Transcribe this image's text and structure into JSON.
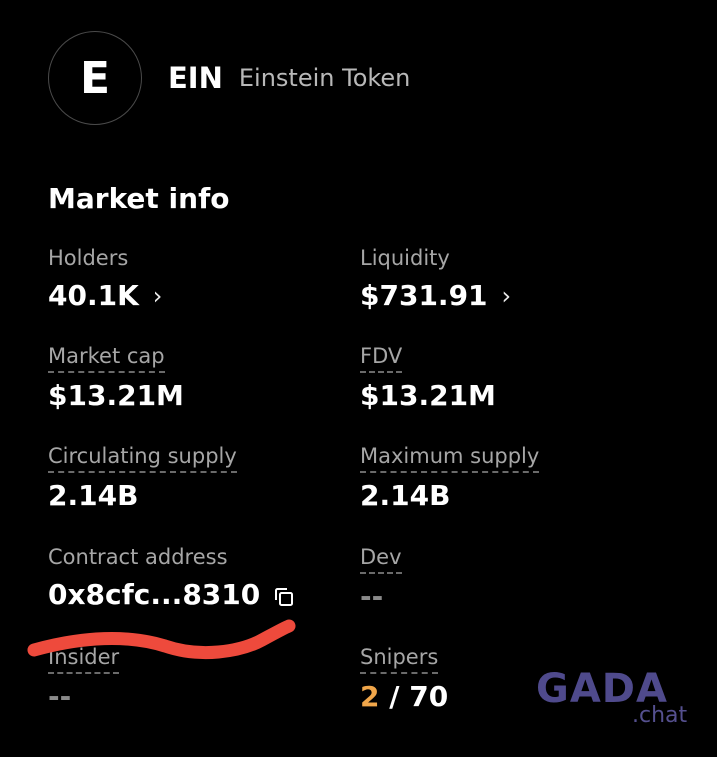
{
  "token": {
    "avatar_letter": "E",
    "symbol": "EIN",
    "name": "Einstein Token"
  },
  "market": {
    "title": "Market info",
    "holders": {
      "label": "Holders",
      "value": "40.1K"
    },
    "liquidity": {
      "label": "Liquidity",
      "value": "$731.91"
    },
    "market_cap": {
      "label": "Market cap",
      "value": "$13.21M"
    },
    "fdv": {
      "label": "FDV",
      "value": "$13.21M"
    },
    "circulating_supply": {
      "label": "Circulating supply",
      "value": "2.14B"
    },
    "maximum_supply": {
      "label": "Maximum supply",
      "value": "2.14B"
    },
    "contract_address": {
      "label": "Contract address",
      "value": "0x8cfc...8310"
    },
    "dev": {
      "label": "Dev",
      "value": "--"
    },
    "insider": {
      "label": "Insider",
      "value": "--"
    },
    "snipers": {
      "label": "Snipers",
      "value": "2",
      "separator": " / ",
      "total": "70"
    }
  },
  "icons": {
    "chevron": "chevron-right-icon",
    "copy": "copy-icon"
  },
  "watermark": {
    "brand": "GADA",
    "suffix": ".chat"
  },
  "colors": {
    "background": "#000000",
    "accent_orange": "#f0a64a",
    "annotation_red": "#ee4a3c",
    "watermark": "#4f4a8c"
  }
}
